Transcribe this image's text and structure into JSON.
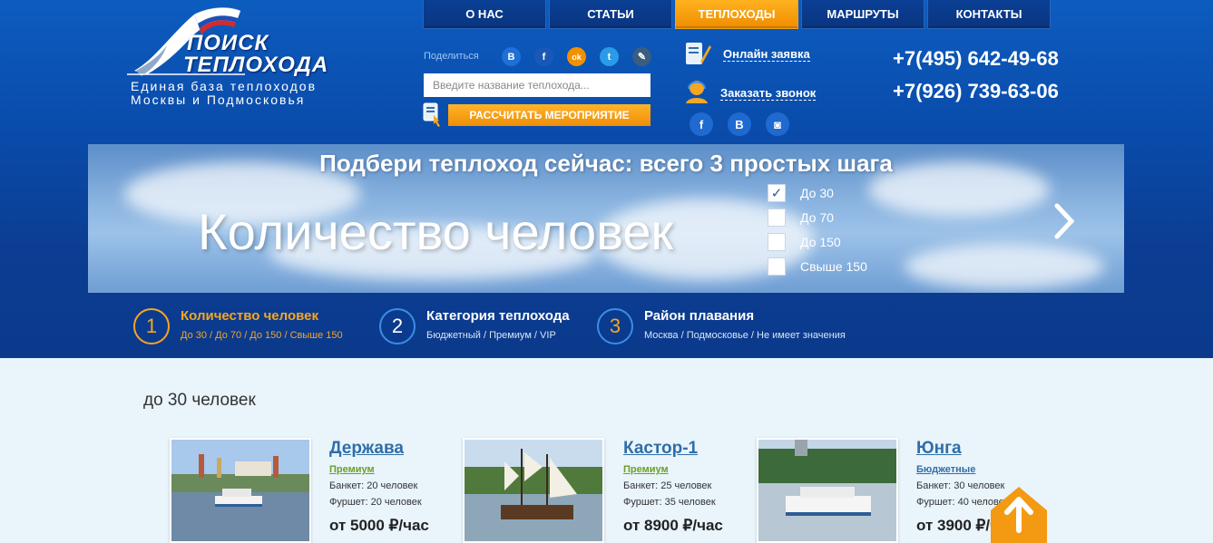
{
  "nav": [
    "О НАС",
    "СТАТЬИ",
    "ТЕПЛОХОДЫ",
    "МАРШРУТЫ",
    "КОНТАКТЫ"
  ],
  "logo": {
    "line1": "ПОИСК",
    "line2": "ТЕПЛОХОДА",
    "tagline1": "Единая база теплоходов",
    "tagline2": "Москвы и Подмосковья"
  },
  "share": {
    "label": "Поделиться",
    "icons": [
      {
        "name": "vk-icon",
        "glyph": "B",
        "color": "#1e6fd8"
      },
      {
        "name": "facebook-icon",
        "glyph": "f",
        "color": "#1a58b8"
      },
      {
        "name": "odnoklassniki-icon",
        "glyph": "ok",
        "color": "#f29100"
      },
      {
        "name": "twitter-icon",
        "glyph": "t",
        "color": "#2a9be8"
      },
      {
        "name": "livejournal-icon",
        "glyph": "✎",
        "color": "#3a5d80"
      }
    ]
  },
  "search": {
    "placeholder": "Введите название теплохода..."
  },
  "calc_button": "РАССЧИТАТЬ МЕРОПРИЯТИЕ",
  "contacts": {
    "online_request": "Онлайн заявка",
    "callback": "Заказать звонок"
  },
  "header_social": [
    {
      "name": "facebook-icon",
      "glyph": "f"
    },
    {
      "name": "vk-icon",
      "glyph": "B"
    },
    {
      "name": "instagram-icon",
      "glyph": "◙"
    }
  ],
  "phones": [
    "+7(495) 642-49-68",
    "+7(926) 739-63-06"
  ],
  "banner": {
    "title": "Подбери теплоход сейчас: всего 3 простых шага",
    "big_text": "Количество человек",
    "options": [
      {
        "label": "До 30",
        "checked": true
      },
      {
        "label": "До 70",
        "checked": false
      },
      {
        "label": "До 150",
        "checked": false
      },
      {
        "label": "Свыше 150",
        "checked": false
      }
    ]
  },
  "steps": [
    {
      "num": "1",
      "title": "Количество человек",
      "sub": "До 30 / До 70 / До 150 / Свыше 150"
    },
    {
      "num": "2",
      "title": "Категория теплохода",
      "sub": "Бюджетный / Премиум / VIP"
    },
    {
      "num": "3",
      "title": "Район плавания",
      "sub": "Москва / Подмосковье / Не имеет значения"
    }
  ],
  "section_title": "до 30 человек",
  "cards": [
    {
      "name": "Держава",
      "category": "Премиум",
      "banquet": "Банкет: 20 человек",
      "buffet": "Фуршет: 20 человек",
      "price": "от 5000 ₽/час"
    },
    {
      "name": "Кастор-1",
      "category": "Премиум",
      "banquet": "Банкет: 25 человек",
      "buffet": "Фуршет: 35 человек",
      "price": "от 8900 ₽/час"
    },
    {
      "name": "Юнга",
      "category": "Бюджетные",
      "banquet": "Банкет: 30 человек",
      "buffet": "Фуршет: 40 человек",
      "price": "от 3900 ₽/час"
    }
  ]
}
